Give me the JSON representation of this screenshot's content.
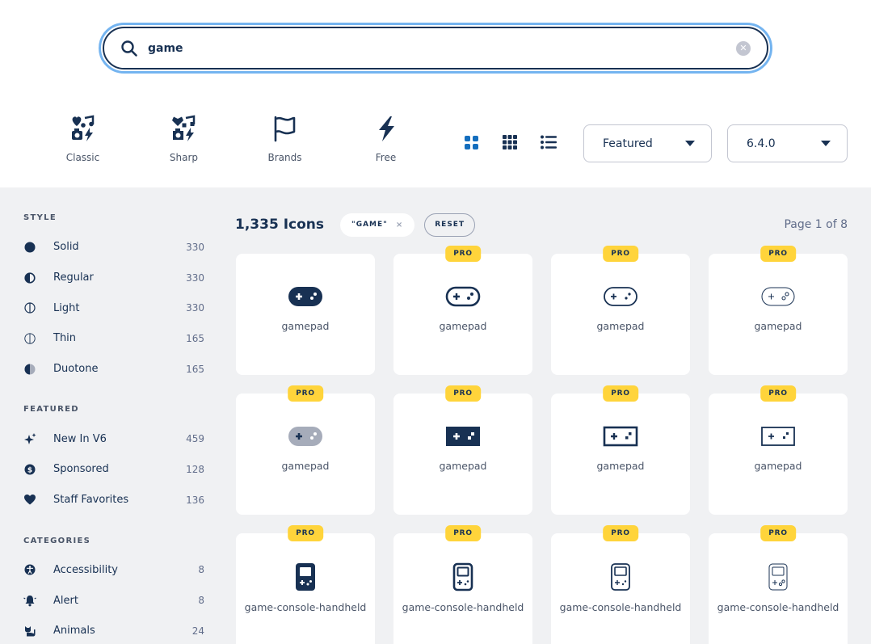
{
  "search": {
    "value": "game",
    "clear_icon": "xmark-circle-icon"
  },
  "families": [
    {
      "label": "Classic",
      "icon": "icons-family-icon"
    },
    {
      "label": "Sharp",
      "icon": "icons-family-sharp-icon"
    },
    {
      "label": "Brands",
      "icon": "flag-icon"
    },
    {
      "label": "Free",
      "icon": "bolt-icon"
    }
  ],
  "views": [
    "large-grid-icon",
    "small-grid-icon",
    "list-icon"
  ],
  "sort_select": {
    "value": "Featured"
  },
  "version_select": {
    "value": "6.4.0"
  },
  "sidebar": {
    "style": {
      "heading": "STYLE",
      "items": [
        {
          "label": "Solid",
          "count": "330",
          "icon": "circle-solid-icon"
        },
        {
          "label": "Regular",
          "count": "330",
          "icon": "circle-half-icon"
        },
        {
          "label": "Light",
          "count": "330",
          "icon": "circle-line-icon"
        },
        {
          "label": "Thin",
          "count": "165",
          "icon": "circle-line-thin-icon"
        },
        {
          "label": "Duotone",
          "count": "165",
          "icon": "circle-duotone-icon"
        }
      ]
    },
    "featured": {
      "heading": "FEATURED",
      "items": [
        {
          "label": "New In V6",
          "count": "459",
          "icon": "sparkles-icon"
        },
        {
          "label": "Sponsored",
          "count": "128",
          "icon": "dollar-circle-icon"
        },
        {
          "label": "Staff Favorites",
          "count": "136",
          "icon": "heart-icon"
        }
      ]
    },
    "categories": {
      "heading": "CATEGORIES",
      "items": [
        {
          "label": "Accessibility",
          "count": "8",
          "icon": "universal-access-icon"
        },
        {
          "label": "Alert",
          "count": "8",
          "icon": "bell-icon"
        },
        {
          "label": "Animals",
          "count": "24",
          "icon": "cat-icon"
        }
      ]
    }
  },
  "results": {
    "count": "1,335 Icons",
    "chip": "\"GAME\"",
    "chip_close": "×",
    "reset": "RESET",
    "page": "Page 1 of 8"
  },
  "cards": [
    {
      "name": "gamepad",
      "pro": "",
      "variant": "gp-solid"
    },
    {
      "name": "gamepad",
      "pro": "PRO",
      "variant": "gp-regular"
    },
    {
      "name": "gamepad",
      "pro": "PRO",
      "variant": "gp-light"
    },
    {
      "name": "gamepad",
      "pro": "PRO",
      "variant": "gp-thin"
    },
    {
      "name": "gamepad",
      "pro": "PRO",
      "variant": "gp-duotone"
    },
    {
      "name": "gamepad",
      "pro": "PRO",
      "variant": "gp-sharp-solid"
    },
    {
      "name": "gamepad",
      "pro": "PRO",
      "variant": "gp-sharp-regular"
    },
    {
      "name": "gamepad",
      "pro": "PRO",
      "variant": "gp-sharp-light"
    },
    {
      "name": "game-console-handheld",
      "pro": "PRO",
      "variant": "hh-solid"
    },
    {
      "name": "game-console-handheld",
      "pro": "PRO",
      "variant": "hh-regular"
    },
    {
      "name": "game-console-handheld",
      "pro": "PRO",
      "variant": "hh-light"
    },
    {
      "name": "game-console-handheld",
      "pro": "PRO",
      "variant": "hh-thin"
    }
  ],
  "colors": {
    "navy": "#183153",
    "accent": "#146ebe",
    "pro": "#ffd43b",
    "bg": "#f0f1f3"
  }
}
